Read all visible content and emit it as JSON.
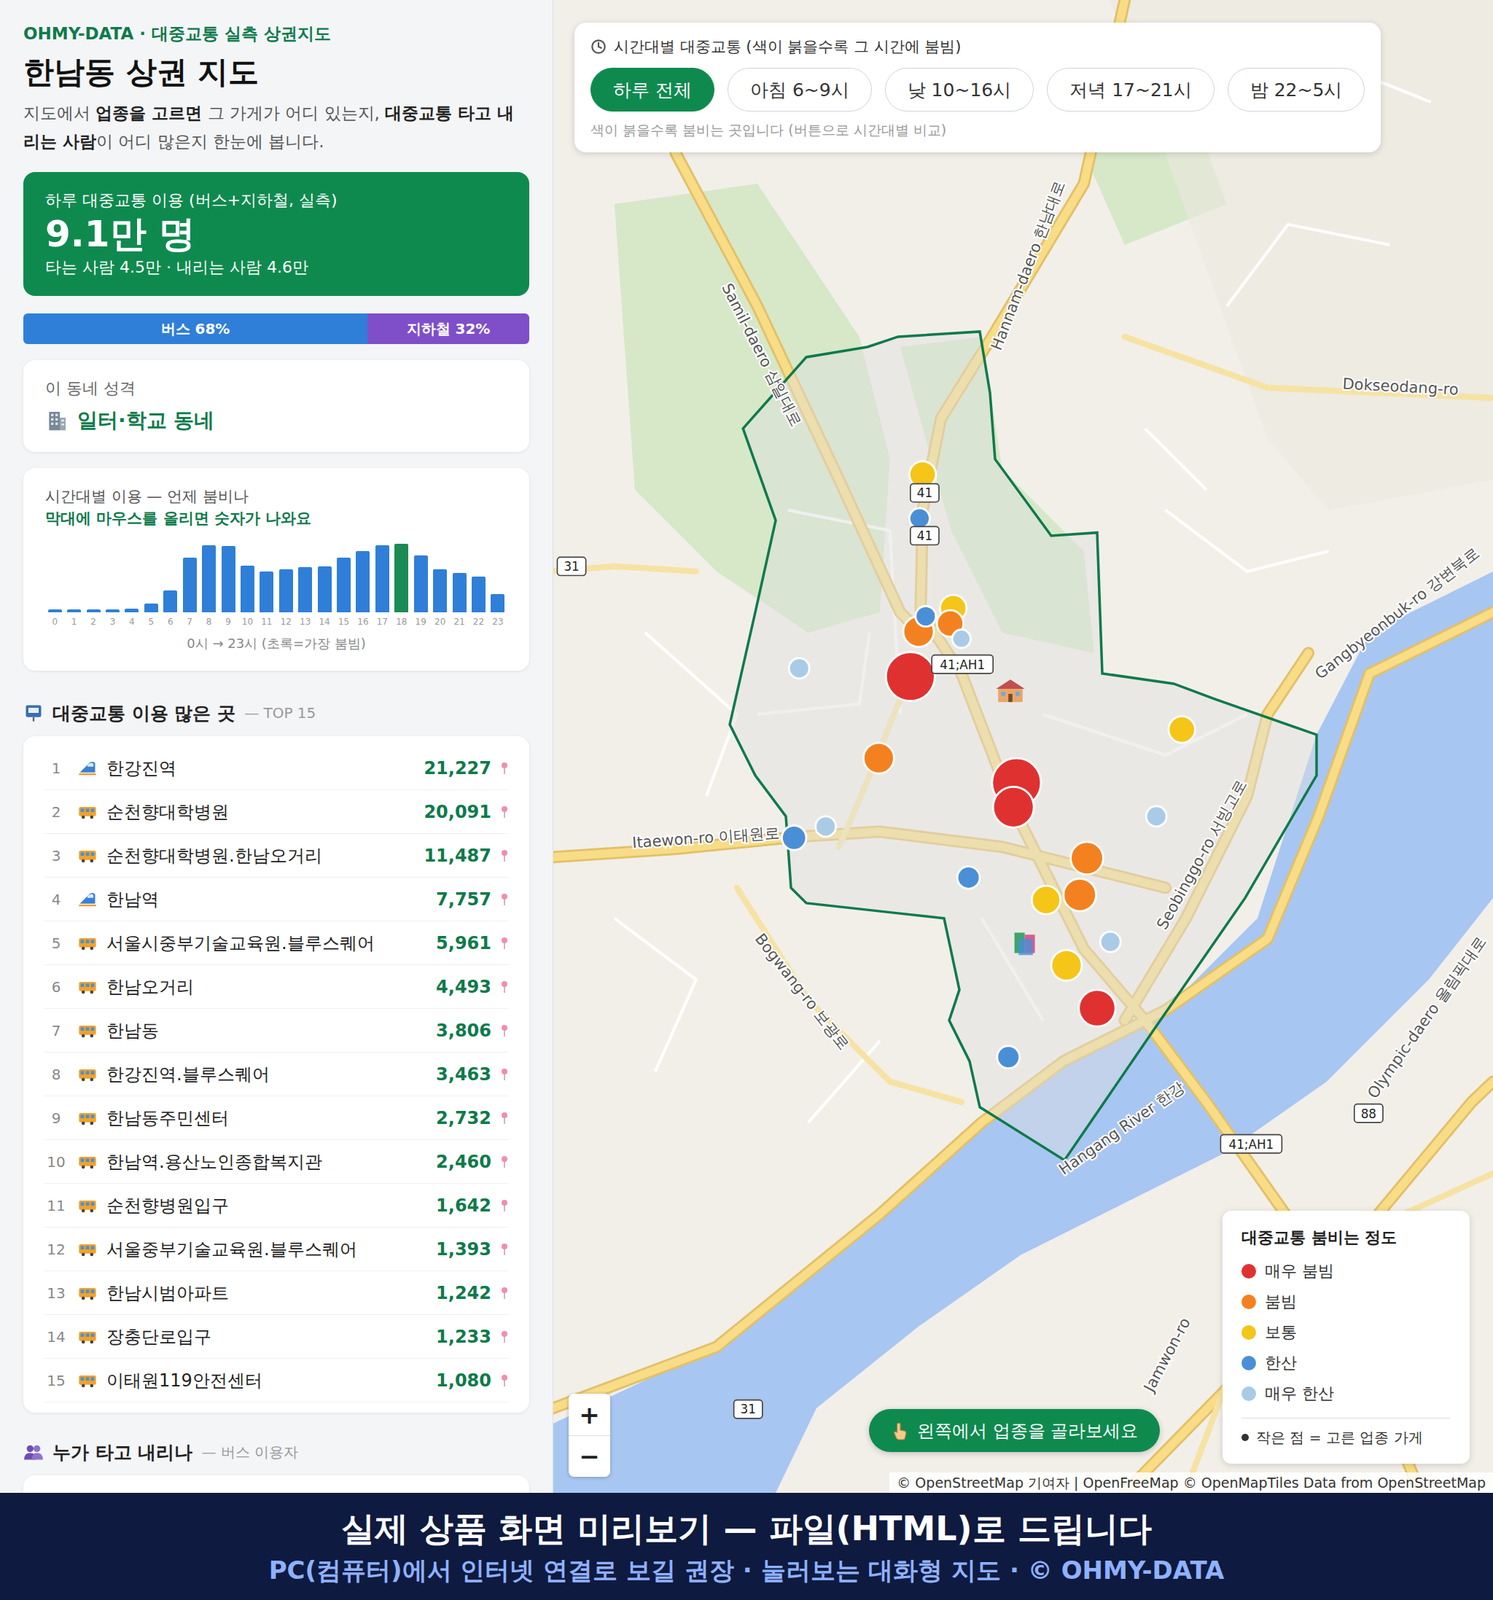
{
  "brand": "OHMY-DATA · 대중교통 실측 상권지도",
  "title": "한남동 상권 지도",
  "intro": [
    {
      "text": "지도에서 ",
      "bold": false
    },
    {
      "text": "업종을 고르면",
      "bold": true
    },
    {
      "text": " 그 가게가 어디 있는지, ",
      "bold": false
    },
    {
      "text": "대중교통 타고 내리는 사람",
      "bold": true
    },
    {
      "text": "이 어디 많은지 한눈에 봅니다.",
      "bold": false
    }
  ],
  "summary": {
    "label": "하루 대중교통 이용 (버스+지하철, 실측)",
    "value": "9.1만 명",
    "detail": "타는 사람 4.5만 · 내리는 사람 4.6만"
  },
  "modes": [
    {
      "label": "버스 68%",
      "level": 0.68,
      "color": "#2f7fd8"
    },
    {
      "label": "지하철 32%",
      "level": 0.32,
      "color": "#7e4fc9"
    }
  ],
  "character": {
    "label": "이 동네 성격",
    "value": "일터·학교 동네"
  },
  "hourly": {
    "title": "시간대별 이용 — 언제 붐비나",
    "hint": "막대에 마우스를 올리면 숫자가 나와요",
    "values": [
      320,
      300,
      280,
      290,
      330,
      850,
      2200,
      5500,
      6700,
      6600,
      4700,
      4100,
      4300,
      4500,
      4600,
      5500,
      6100,
      6700,
      6850,
      5700,
      4300,
      3900,
      3600,
      1800
    ],
    "ticks": [
      "0",
      "1",
      "2",
      "3",
      "4",
      "5",
      "6",
      "7",
      "8",
      "9",
      "10",
      "11",
      "12",
      "13",
      "14",
      "15",
      "16",
      "17",
      "18",
      "19",
      "20",
      "21",
      "22",
      "23"
    ],
    "caption": "0시 → 23시 (초록=가장 붐빔)"
  },
  "top": {
    "title": "대중교통 이용 많은 곳",
    "suffix": "— TOP 15",
    "rows": [
      {
        "rank": "1",
        "kind": "subway",
        "name": "한강진역",
        "count": "21,227"
      },
      {
        "rank": "2",
        "kind": "bus",
        "name": "순천향대학병원",
        "count": "20,091"
      },
      {
        "rank": "3",
        "kind": "bus",
        "name": "순천향대학병원.한남오거리",
        "count": "11,487"
      },
      {
        "rank": "4",
        "kind": "subway",
        "name": "한남역",
        "count": "7,757"
      },
      {
        "rank": "5",
        "kind": "bus",
        "name": "서울시중부기술교육원.블루스퀘어",
        "count": "5,961"
      },
      {
        "rank": "6",
        "kind": "bus",
        "name": "한남오거리",
        "count": "4,493"
      },
      {
        "rank": "7",
        "kind": "bus",
        "name": "한남동",
        "count": "3,806"
      },
      {
        "rank": "8",
        "kind": "bus",
        "name": "한강진역.블루스퀘어",
        "count": "3,463"
      },
      {
        "rank": "9",
        "kind": "bus",
        "name": "한남동주민센터",
        "count": "2,732"
      },
      {
        "rank": "10",
        "kind": "bus",
        "name": "한남역.용산노인종합복지관",
        "count": "2,460"
      },
      {
        "rank": "11",
        "kind": "bus",
        "name": "순천향병원입구",
        "count": "1,642"
      },
      {
        "rank": "12",
        "kind": "bus",
        "name": "서울중부기술교육원.블루스퀘어",
        "count": "1,393"
      },
      {
        "rank": "13",
        "kind": "bus",
        "name": "한남시범아파트",
        "count": "1,242"
      },
      {
        "rank": "14",
        "kind": "bus",
        "name": "장충단로입구",
        "count": "1,233"
      },
      {
        "rank": "15",
        "kind": "bus",
        "name": "이태원119안전센터",
        "count": "1,080"
      }
    ]
  },
  "riders": {
    "title": "누가 타고 내리나",
    "suffix": "— 버스 이용자"
  },
  "timeFilter": {
    "title": "시간대별 대중교통 (색이 붉을수록 그 시간에 붐빔)",
    "buttons": [
      {
        "label": "하루 전체",
        "selected": true
      },
      {
        "label": "아침 6~9시",
        "selected": false
      },
      {
        "label": "낮 10~16시",
        "selected": false
      },
      {
        "label": "저녁 17~21시",
        "selected": false
      },
      {
        "label": "밤 22~5시",
        "selected": false
      }
    ],
    "note": "색이 붉을수록 붐비는 곳입니다 (버튼으로 시간대별 비교)"
  },
  "legend": {
    "title": "대중교통 붐비는 정도",
    "items": [
      {
        "label": "매우 붐빔",
        "color": "#e03131"
      },
      {
        "label": "붐빔",
        "color": "#f4811f"
      },
      {
        "label": "보통",
        "color": "#f5c518"
      },
      {
        "label": "한산",
        "color": "#4a8fd6"
      },
      {
        "label": "매우 한산",
        "color": "#a9cbe7"
      }
    ],
    "note": "작은 점 = 고른 업종 가게"
  },
  "hint": "왼쪽에서 업종을 골라보세요",
  "zoom": [
    "+",
    "−"
  ],
  "attribution": "© OpenStreetMap 기여자 | OpenFreeMap © OpenMapTiles Data from OpenStreetMap",
  "map": {
    "labels": [
      "Samil-daero 삼일대로",
      "Itaewon-ro 이태원로",
      "Bogwang-ro 보광로",
      "Hannam-daero 한남대로",
      "Seobinggo-ro 서빙고로",
      "Hangang River 한강",
      "Gangbyeonbuk-ro 강변북로",
      "Dokseodang-ro",
      "Jamwon-ro",
      "Olympic-daero 올림픽대로"
    ],
    "shields": [
      "41",
      "41",
      "41;AH1",
      "31",
      "88",
      "41;AH1",
      "31"
    ],
    "markers": [
      {
        "color": "#f5c518"
      },
      {
        "color": "#4a8fd6"
      },
      {
        "color": "#f5c518"
      },
      {
        "color": "#f4811f"
      },
      {
        "color": "#f4811f"
      },
      {
        "color": "#4a8fd6"
      },
      {
        "color": "#a9cbe7"
      },
      {
        "color": "#e03131"
      },
      {
        "color": "#a9cbe7"
      },
      {
        "color": "#f4811f"
      },
      {
        "color": "#f5c518"
      },
      {
        "color": "#e03131"
      },
      {
        "color": "#e03131"
      },
      {
        "color": "#a9cbe7"
      },
      {
        "color": "#4a8fd6"
      },
      {
        "color": "#a9cbe7"
      },
      {
        "color": "#4a8fd6"
      },
      {
        "color": "#f4811f"
      },
      {
        "color": "#f4811f"
      },
      {
        "color": "#f5c518"
      },
      {
        "color": "#a9cbe7"
      },
      {
        "color": "#f5c518"
      },
      {
        "color": "#e03131"
      },
      {
        "color": "#4a8fd6"
      }
    ]
  },
  "banner": {
    "title": "실제 상품 화면 미리보기 — 파일(HTML)로 드립니다",
    "subtitle": "PC(컴퓨터)에서 인터넷 연결로 보길 권장 · 눌러보는 대화형 지도 · © OHMY-DATA"
  }
}
